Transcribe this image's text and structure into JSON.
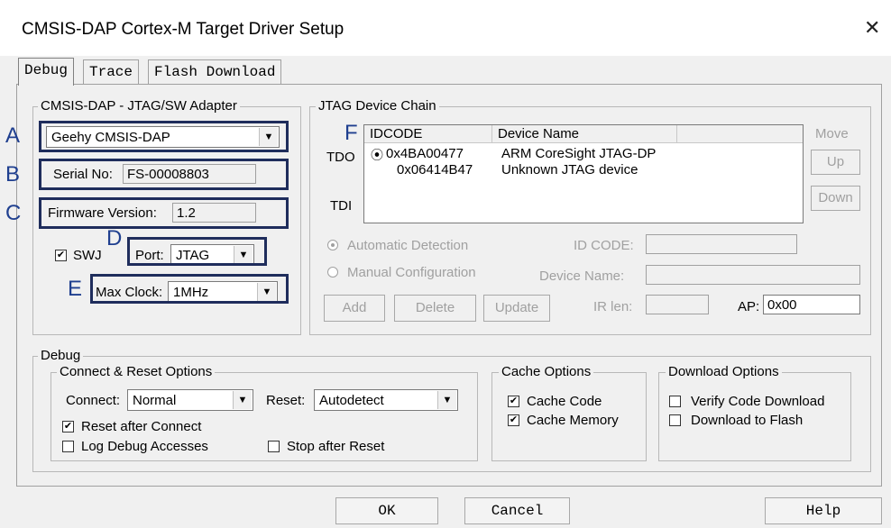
{
  "window": {
    "title": "CMSIS-DAP Cortex-M Target Driver Setup",
    "close": "✕"
  },
  "tabs": [
    {
      "label": "Debug"
    },
    {
      "label": "Trace"
    },
    {
      "label": "Flash Download"
    }
  ],
  "adapter": {
    "legend": "CMSIS-DAP - JTAG/SW Adapter",
    "device": "Geehy CMSIS-DAP",
    "serial_label": "Serial No:",
    "serial_value": "FS-00008803",
    "firmware_label": "Firmware Version:",
    "firmware_value": "1.2",
    "swj_label": "SWJ",
    "port_label": "Port:",
    "port_value": "JTAG",
    "max_clock_label": "Max Clock:",
    "max_clock_value": "1MHz"
  },
  "jtag_chain": {
    "legend": "JTAG Device Chain",
    "columns": [
      "IDCODE",
      "Device Name"
    ],
    "tdo": "TDO",
    "tdi": "TDI",
    "rows": [
      {
        "idcode": "0x4BA00477",
        "name": "ARM CoreSight JTAG-DP"
      },
      {
        "idcode": "0x06414B47",
        "name": "Unknown JTAG device"
      }
    ],
    "move_label": "Move",
    "up_label": "Up",
    "down_label": "Down",
    "auto_detect": "Automatic Detection",
    "manual_config": "Manual Configuration",
    "id_code_label": "ID CODE:",
    "device_name_label": "Device Name:",
    "ir_len_label": "IR len:",
    "ap_label": "AP:",
    "ap_value": "0x00",
    "add_label": "Add",
    "delete_label": "Delete",
    "update_label": "Update"
  },
  "debug": {
    "legend": "Debug",
    "connect_reset_legend": "Connect & Reset Options",
    "connect_label": "Connect:",
    "connect_value": "Normal",
    "reset_label": "Reset:",
    "reset_value": "Autodetect",
    "reset_after_connect": "Reset after Connect",
    "log_debug": "Log Debug Accesses",
    "stop_after_reset": "Stop after Reset",
    "cache_legend": "Cache Options",
    "cache_code": "Cache Code",
    "cache_memory": "Cache Memory",
    "download_legend": "Download Options",
    "verify_code": "Verify Code Download",
    "download_flash": "Download to Flash"
  },
  "annotations": {
    "a": "A",
    "b": "B",
    "c": "C",
    "d": "D",
    "e": "E",
    "f": "F"
  },
  "footer": {
    "ok": "OK",
    "cancel": "Cancel",
    "help": "Help"
  },
  "check_mark": "✔",
  "combo_arrow": "▼"
}
